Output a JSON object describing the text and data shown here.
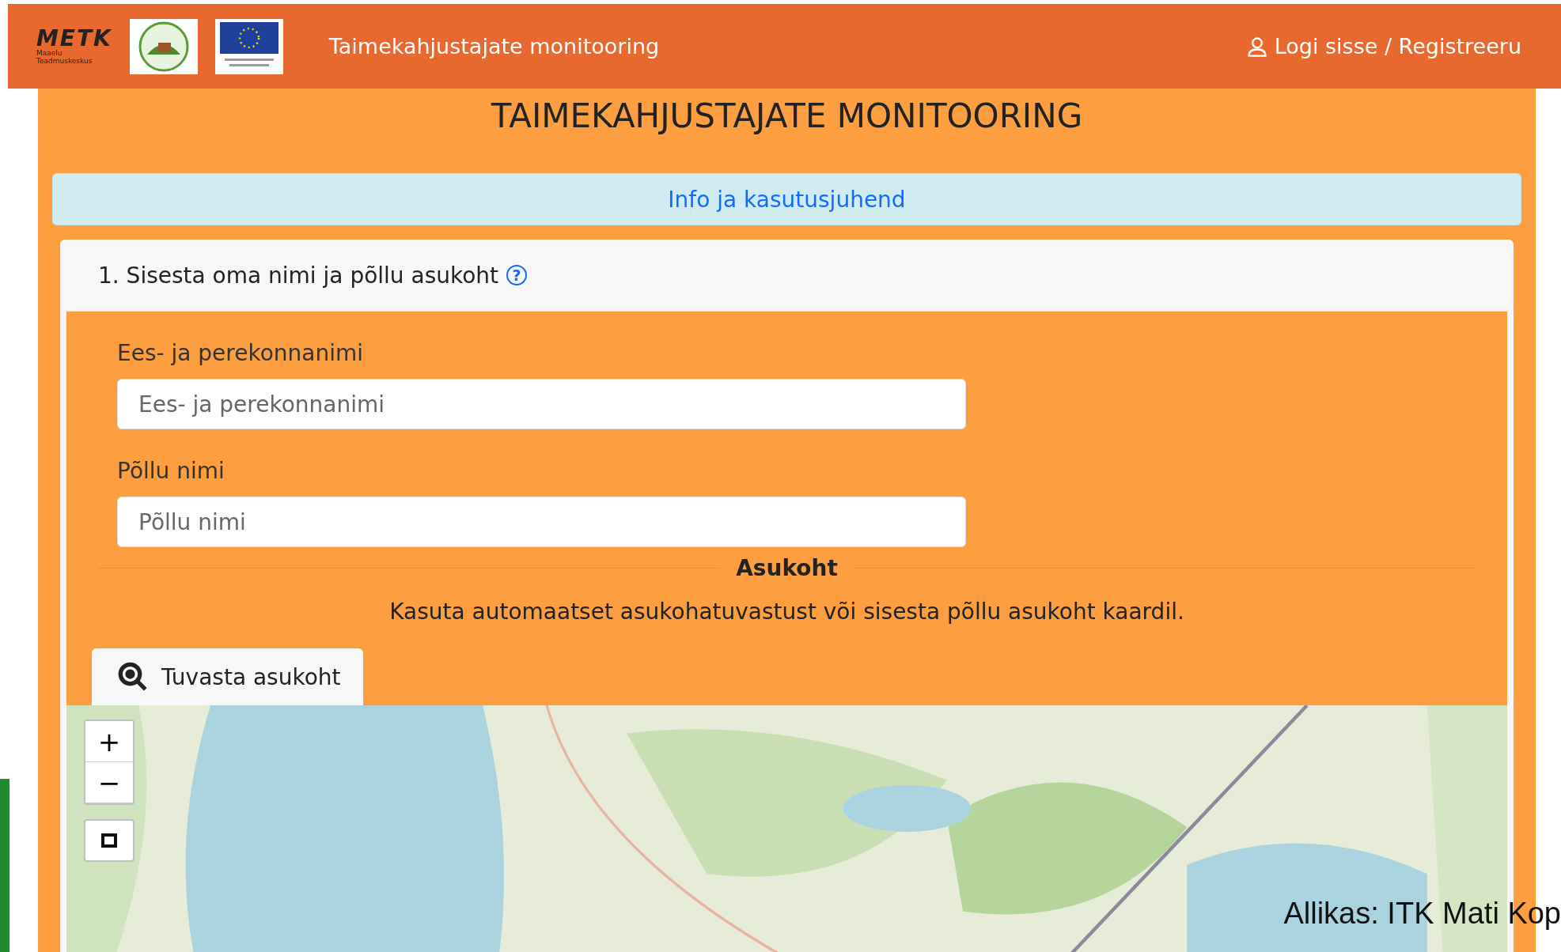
{
  "header": {
    "logo_text": "METK",
    "logo_subtitle": "Maaelu Teadmuskeskus",
    "site_title": "Taimekahjustajate monitooring",
    "login": "Logi sisse / Registreeru"
  },
  "page_title": "TAIMEKAHJUSTAJATE MONITOORING",
  "info_bar": "Info ja kasutusjuhend",
  "card": {
    "title": "1. Sisesta oma nimi ja põllu asukoht",
    "help": "?",
    "fields": [
      {
        "label": "Ees- ja perekonnanimi",
        "placeholder": "Ees- ja perekonnanimi"
      },
      {
        "label": "Põllu nimi",
        "placeholder": "Põllu nimi"
      }
    ],
    "location_heading": "Asukoht",
    "location_text": "Kasuta automaatset asukohatuvastust või sisesta põllu asukoht kaardil.",
    "locate_button": "Tuvasta asukoht",
    "map": {
      "kind": "picture",
      "controls": [
        "+",
        "−"
      ]
    }
  },
  "caption": "Allikas: ITK Mati Kop"
}
